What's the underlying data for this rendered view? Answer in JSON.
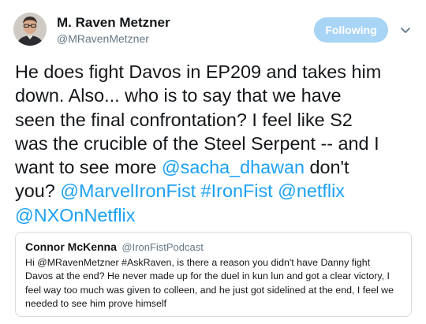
{
  "author": {
    "display_name": "M. Raven Metzner",
    "handle": "@MRavenMetzner"
  },
  "follow_button": {
    "label": "Following"
  },
  "tweet": {
    "lines": [
      [
        {
          "t": "He does fight Davos in EP209 and takes him"
        }
      ],
      [
        {
          "t": "down.   Also... who is to say that we have"
        }
      ],
      [
        {
          "t": "seen the final confrontation?  I feel like S2"
        }
      ],
      [
        {
          "t": "was the crucible of the Steel Serpent -- and I"
        }
      ],
      [
        {
          "t": "want to see more "
        },
        {
          "t": "@sacha_dhawan",
          "link": true
        },
        {
          "t": " don't"
        }
      ],
      [
        {
          "t": "you?  "
        },
        {
          "t": "@MarvelIronFist",
          "link": true
        },
        {
          "t": " "
        },
        {
          "t": "#IronFist",
          "link": true
        },
        {
          "t": " "
        },
        {
          "t": "@netflix",
          "link": true
        }
      ],
      [
        {
          "t": "@NXOnNetflix",
          "link": true
        }
      ]
    ]
  },
  "quoted_tweet": {
    "name": "Connor McKenna",
    "handle": "@IronFistPodcast",
    "lines": [
      "Hi @MRavenMetzner #AskRaven, is there a reason you didn't have Danny fight",
      "Davos at the end? He never made up for the duel in kun lun and got a clear victory, I",
      "feel way too much was given to colleen, and he just got sidelined at the end, I feel we",
      "needed to see him prove himself"
    ]
  },
  "colors": {
    "link": "#1da1f2",
    "follow_button_bg": "#a8d4f5",
    "secondary_text": "#657786",
    "border": "#d6dce1"
  },
  "icons": {
    "avatar": "profile-photo",
    "menu": "chevron-down-icon"
  }
}
